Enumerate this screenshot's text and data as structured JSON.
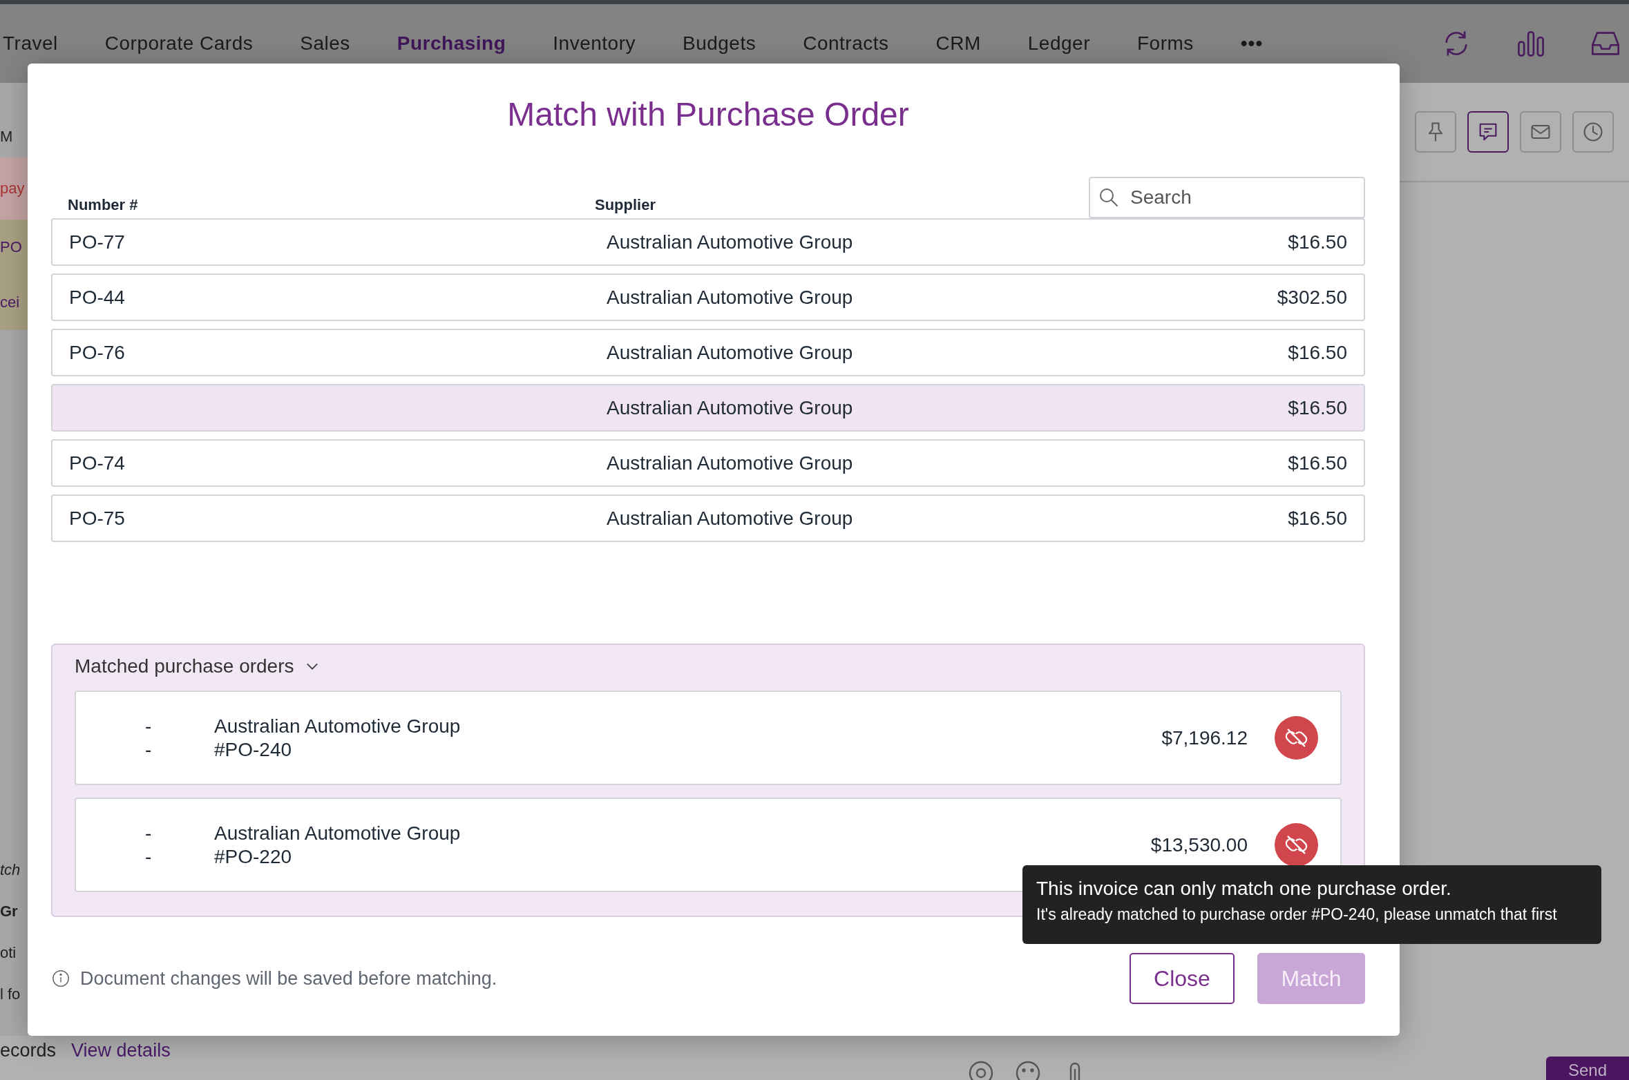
{
  "nav": {
    "items": [
      {
        "label": "Travel",
        "selected": false
      },
      {
        "label": "Corporate Cards",
        "selected": false
      },
      {
        "label": "Sales",
        "selected": false
      },
      {
        "label": "Purchasing",
        "selected": true
      },
      {
        "label": "Inventory",
        "selected": false
      },
      {
        "label": "Budgets",
        "selected": false
      },
      {
        "label": "Contracts",
        "selected": false
      },
      {
        "label": "CRM",
        "selected": false
      },
      {
        "label": "Ledger",
        "selected": false
      },
      {
        "label": "Forms",
        "selected": false
      }
    ],
    "more": "•••",
    "actions": [
      {
        "kind": "refresh"
      },
      {
        "kind": "chart"
      },
      {
        "kind": "inbox"
      }
    ]
  },
  "side_fragments": [
    {
      "text": "M",
      "kind": "plain"
    },
    {
      "text": "pay",
      "kind": "alert"
    },
    {
      "text": "PO",
      "kind": "link"
    },
    {
      "text": "cei",
      "kind": "link"
    },
    {
      "text": "tch",
      "kind": "italic"
    },
    {
      "text": "Gr",
      "kind": "bold"
    },
    {
      "text": "oti",
      "kind": "plain"
    },
    {
      "text": "l fo",
      "kind": "plain"
    }
  ],
  "toolbar": [
    {
      "kind": "pin",
      "selected": false
    },
    {
      "kind": "comment",
      "selected": true
    },
    {
      "kind": "mail",
      "selected": false
    },
    {
      "kind": "clock",
      "selected": false
    }
  ],
  "footer": {
    "text": "ecords",
    "link": "View details",
    "composer_icons": [
      {
        "kind": "mention"
      },
      {
        "kind": "emoji"
      },
      {
        "kind": "attach"
      }
    ],
    "send": "Send"
  },
  "modal": {
    "title": "Match with Purchase Order",
    "search": {
      "placeholder": "Search"
    },
    "columns": [
      "Number #",
      "Supplier"
    ],
    "rows": [
      {
        "number": "PO-77",
        "supplier": "Australian Automotive Group",
        "amount": "$16.50",
        "selected": false
      },
      {
        "number": "PO-44",
        "supplier": "Australian Automotive Group",
        "amount": "$302.50",
        "selected": false
      },
      {
        "number": "PO-76",
        "supplier": "Australian Automotive Group",
        "amount": "$16.50",
        "selected": false
      },
      {
        "supplier": "Australian Automotive Group",
        "amount": "$16.50",
        "selected": true
      },
      {
        "number": "PO-74",
        "supplier": "Australian Automotive Group",
        "amount": "$16.50",
        "selected": false
      },
      {
        "number": "PO-75",
        "supplier": "Australian Automotive Group",
        "amount": "$16.50",
        "selected": false
      }
    ],
    "matched": {
      "title": "Matched purchase orders",
      "expanded": true,
      "items": [
        {
          "dash_1": "-",
          "dash_2": "-",
          "supplier": "Australian Automotive Group",
          "po": "#PO-240",
          "amount": "$7,196.12"
        },
        {
          "dash_1": "-",
          "dash_2": "-",
          "supplier": "Australian Automotive Group",
          "po": "#PO-220",
          "amount": "$13,530.00"
        }
      ]
    },
    "note": "Document changes will be saved before matching.",
    "buttons": [
      {
        "label": "Close",
        "kind": "secondary",
        "disabled": false
      },
      {
        "label": "Match",
        "kind": "primary",
        "disabled": true
      }
    ],
    "tooltip": {
      "title": "This invoice can only match one purchase order.",
      "text": "It's already matched to purchase order #PO-240, please unmatch that first"
    }
  }
}
